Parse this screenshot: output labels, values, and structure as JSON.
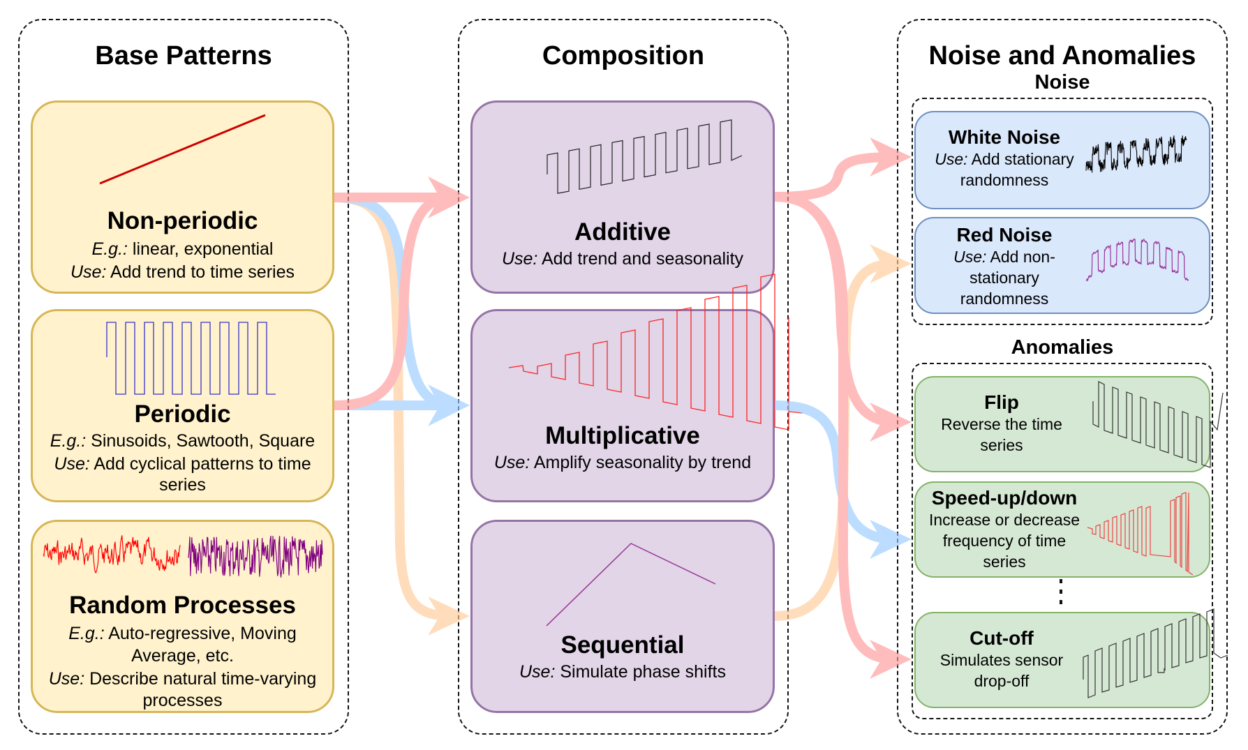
{
  "columns": {
    "base": {
      "title": "Base Patterns",
      "boxes": [
        {
          "title": "Non-periodic",
          "eg_label": "E.g.:",
          "eg_text": " linear, exponential",
          "use_label": "Use:",
          "use_text": " Add trend to time series",
          "figure": "linear-trend-line"
        },
        {
          "title": "Periodic",
          "eg_label": "E.g.:",
          "eg_text": " Sinusoids, Sawtooth, Square",
          "use_label": "Use:",
          "use_text": " Add cyclical patterns to time",
          "use_text2": "series",
          "figure": "square-wave"
        },
        {
          "title": "Random Processes",
          "eg_label": "E.g.:",
          "eg_text": " Auto-regressive, Moving",
          "eg_text2": "Average, etc.",
          "use_label": "Use:",
          "use_text": " Describe natural time-varying",
          "use_text2": "processes",
          "figure": "noise-traces"
        }
      ]
    },
    "composition": {
      "title": "Composition",
      "boxes": [
        {
          "title": "Additive",
          "use_label": "Use:",
          "use_text": " Add trend and seasonality",
          "figure": "square-wave-with-trend"
        },
        {
          "title": "Multiplicative",
          "use_label": "Use:",
          "use_text": " Amplify seasonality by trend",
          "figure": "growing-square-wave"
        },
        {
          "title": "Sequential",
          "use_label": "Use:",
          "use_text": " Simulate phase shifts",
          "figure": "up-down-trend"
        }
      ]
    },
    "noise_anomalies": {
      "title": "Noise and Anomalies",
      "noise": {
        "label": "Noise",
        "boxes": [
          {
            "title": "White Noise",
            "use_label": "Use:",
            "use_text": " Add stationary",
            "use_text2": "randomness",
            "figure": "noisy-square-wave"
          },
          {
            "title": "Red Noise",
            "use_label": "Use:",
            "use_text": " Add non-",
            "use_text2": "stationary",
            "use_text3": "randomness",
            "figure": "red-noise-wave"
          }
        ]
      },
      "anomalies": {
        "label": "Anomalies",
        "boxes": [
          {
            "title": "Flip",
            "desc": "Reverse the time",
            "desc2": "series",
            "figure": "flipped-wave"
          },
          {
            "title": "Speed-up/down",
            "desc": "Increase or decrease",
            "desc2": "frequency of time",
            "desc3": "series",
            "figure": "speed-change-wave"
          },
          {
            "title": "Cut-off",
            "desc": "Simulates sensor",
            "desc2": "drop-off",
            "figure": "cutoff-wave"
          }
        ],
        "ellipsis": "more anomalies"
      }
    }
  },
  "connections": [
    {
      "from": "Non-periodic",
      "to": "Additive",
      "color": "#ff9999"
    },
    {
      "from": "Non-periodic",
      "to": "Multiplicative",
      "color": "#99ccff"
    },
    {
      "from": "Non-periodic",
      "to": "Sequential",
      "color": "#ffcc99"
    },
    {
      "from": "Periodic",
      "to": "Additive",
      "color": "#ff9999"
    },
    {
      "from": "Periodic",
      "to": "Multiplicative",
      "color": "#99ccff"
    },
    {
      "from": "Additive",
      "to": "White Noise",
      "color": "#ff9999"
    },
    {
      "from": "Additive",
      "to": "Flip",
      "color": "#ff9999"
    },
    {
      "from": "Additive",
      "to": "Cut-off",
      "color": "#ff9999"
    },
    {
      "from": "Multiplicative",
      "to": "Speed-up/down",
      "color": "#99ccff"
    },
    {
      "from": "Sequential",
      "to": "Red Noise",
      "color": "#ffcc99"
    }
  ],
  "colors": {
    "base_fill": "#fff2cc",
    "base_stroke": "#d6b656",
    "comp_fill": "#e1d5e7",
    "comp_stroke": "#9673a6",
    "noise_fill": "#dae8fc",
    "noise_stroke": "#6c8ebf",
    "anom_fill": "#d5e8d4",
    "anom_stroke": "#82b366"
  }
}
